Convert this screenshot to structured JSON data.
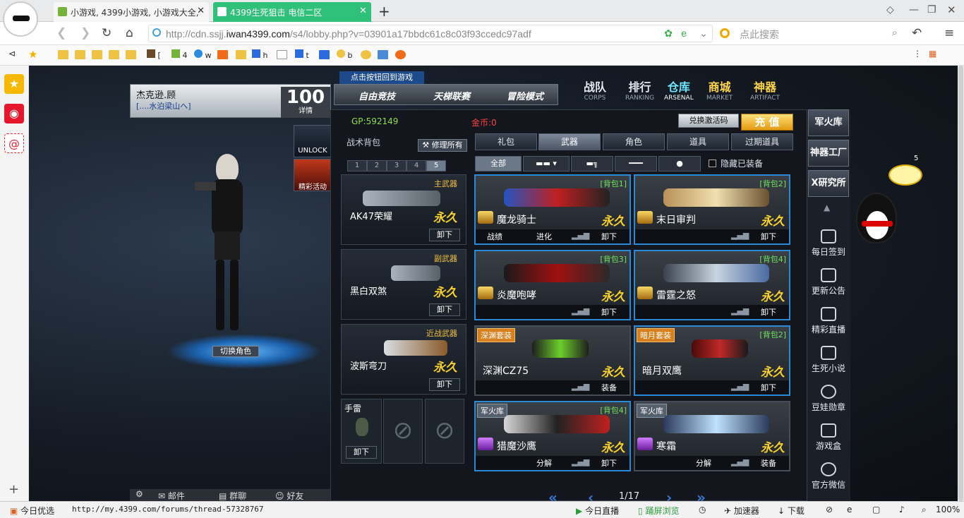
{
  "browser": {
    "tabs": [
      {
        "label": "小游戏, 4399小游戏, 小游戏大全,"
      },
      {
        "label": "4399生死狙击  电信二区"
      }
    ],
    "url_prefix": "http://cdn.ssjj.",
    "url_domain": "iwan4399.com",
    "url_suffix": "/s4/lobby.php?v=03901a17bbdc61c8c03f93ccedc97adf",
    "search_placeholder": "点此搜索",
    "bookmarks": [
      "[",
      "4",
      "w",
      "h",
      "t",
      "b"
    ]
  },
  "status_bar": {
    "left_label": "今日优选",
    "link": "http://my.4399.com/forums/thread-57328767",
    "live": "今日直播",
    "split_view": "踊屏浏览",
    "accelerator": "加速器",
    "download": "下载",
    "zoom": "100%"
  },
  "game": {
    "player_name": "杰克逊.顾",
    "clan": "[....水泊梁山へ]",
    "level": "100",
    "level_label": "详情",
    "unlock": "UNLOCK",
    "event": "精彩活动",
    "switch_role": "切换角色",
    "bottom": [
      "邮件",
      "群聊",
      "好友"
    ],
    "mode_hint": "点击按钮回到游戏",
    "modes": [
      "自由竞技",
      "天梯联赛",
      "冒险模式"
    ],
    "nav": [
      {
        "cn": "战队",
        "en": "CORPS"
      },
      {
        "cn": "排行",
        "en": "RANKING"
      },
      {
        "cn": "仓库",
        "en": "ARSENAL"
      },
      {
        "cn": "商城",
        "en": "MARKET"
      },
      {
        "cn": "神器",
        "en": "ARTIFACT"
      }
    ],
    "gp": "GP:592149",
    "gold": "金币:0",
    "redeem": "兑换激活码",
    "recharge": "充 值",
    "bag_title": "战术背包",
    "repair_all": "修理所有",
    "bag_pages": [
      "1",
      "2",
      "3",
      "4",
      "5"
    ],
    "equipped": [
      {
        "type": "主武器",
        "name": "AK47荣耀",
        "perm": "永久",
        "action": "卸下"
      },
      {
        "type": "副武器",
        "name": "黑白双煞",
        "perm": "永久",
        "action": "卸下"
      },
      {
        "type": "近战武器",
        "name": "波斯弯刀",
        "perm": "永久",
        "action": "卸下"
      }
    ],
    "grenade": {
      "label": "手雷",
      "action": "卸下"
    },
    "categories": [
      "礼包",
      "武器",
      "角色",
      "道具",
      "过期道具"
    ],
    "sub_all": "全部",
    "hide_equipped": "隐藏已装备",
    "cards": [
      {
        "name": "魔龙骑士",
        "bag": "[背包1]",
        "set": "",
        "footer": [
          "战绩",
          "进化",
          "卸下"
        ],
        "perm": "永久"
      },
      {
        "name": "末日审判",
        "bag": "[背包2]",
        "set": "",
        "footer": [
          "卸下"
        ],
        "perm": "永久"
      },
      {
        "name": "炎魔咆哮",
        "bag": "[背包3]",
        "set": "",
        "footer": [
          "卸下"
        ],
        "perm": "永久"
      },
      {
        "name": "雷霆之怒",
        "bag": "[背包4]",
        "set": "",
        "footer": [
          "卸下"
        ],
        "perm": "永久"
      },
      {
        "name": "深渊CZ75",
        "bag": "",
        "set": "深渊套装",
        "footer": [
          "装备"
        ],
        "perm": "永久"
      },
      {
        "name": "暗月双鹰",
        "bag": "[背包2]",
        "set": "暗月套装",
        "footer": [
          "卸下"
        ],
        "perm": "永久"
      },
      {
        "name": "猎魔沙鹰",
        "bag": "[背包4]",
        "set": "军火库",
        "footer": [
          "分解",
          "卸下"
        ],
        "perm": "永久"
      },
      {
        "name": "寒霜",
        "bag": "",
        "set": "军火库",
        "footer": [
          "分解",
          "装备"
        ],
        "perm": "永久"
      }
    ],
    "page": "1/17",
    "right_tabs": [
      "军火库",
      "神器工厂",
      "X研究所"
    ],
    "right_items": [
      "每日签到",
      "更新公告",
      "精彩直播",
      "生死小说",
      "豆娃勋章",
      "游戏盒",
      "官方微信"
    ],
    "bulb_count": "5"
  }
}
